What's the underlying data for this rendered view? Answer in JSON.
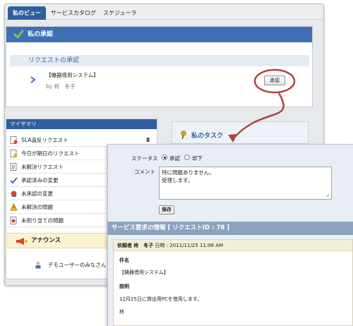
{
  "tabs": [
    "私のビュー",
    "サービスカタログ",
    "スケジューラ"
  ],
  "approval": {
    "header": "私の承認",
    "subheader": "リクエストの承認",
    "request_title": "【機器借用システム】",
    "request_by": "by 柊　冬子",
    "approve_label": "承認"
  },
  "summary": {
    "header": "マイサマリ",
    "items": [
      {
        "label": "SLA違反リクエスト",
        "count": "8"
      },
      {
        "label": "今日が期日のリクエスト",
        "count": ""
      },
      {
        "label": "未解決リクエスト",
        "count": ""
      },
      {
        "label": "承認済みの変更",
        "count": ""
      },
      {
        "label": "未承認の変更",
        "count": ""
      },
      {
        "label": "未解決の問題",
        "count": ""
      },
      {
        "label": "未割り当ての問題",
        "count": ""
      }
    ]
  },
  "announcement": {
    "header": "アナウンス",
    "item": "デモユーザーのみなさん"
  },
  "task": {
    "title": "私のタスク"
  },
  "detail": {
    "status_label": "ステータス",
    "status_options": [
      "承認",
      "却下"
    ],
    "status_selected": "承認",
    "comment_label": "コメント",
    "comment_lines": [
      "特に問題ありません。",
      "受理します。"
    ],
    "save_label": "保存",
    "info_header": "サービス要求の情報 [ リクエストID : 78 ]",
    "meta_requester_label": "依頼者",
    "meta_requester": "柊　冬子",
    "meta_datetime_label": "日時 :",
    "meta_datetime": "2011/11/25 11:06 AM",
    "subject_label": "件名",
    "subject": "【機器借用システム】",
    "description_label": "説明",
    "description": "12月25日に貸出用PCを借用します。",
    "signature": "柊"
  },
  "colors": {
    "tab_active": "#2f5f9f",
    "panel_header": "#3f6fb5",
    "callout": "#b0413e",
    "info_header": "#8ca3bf"
  }
}
